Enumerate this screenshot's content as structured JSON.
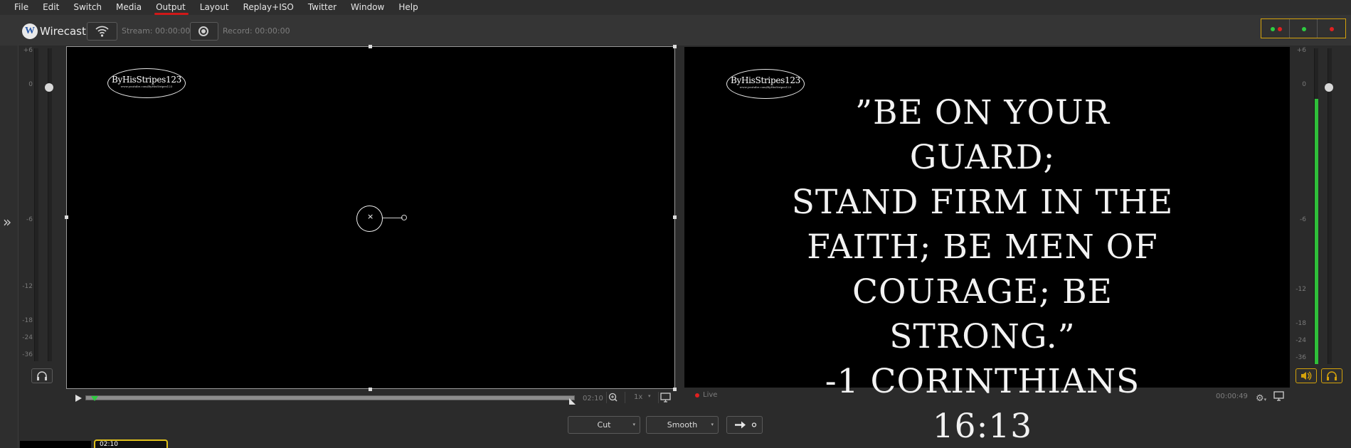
{
  "menu": [
    "File",
    "Edit",
    "Switch",
    "Media",
    "Output",
    "Layout",
    "Replay+ISO",
    "Twitter",
    "Window",
    "Help"
  ],
  "toolbar": {
    "app_name": "Wirecast",
    "stream_label": "Stream: 00:00:00",
    "record_label": "Record: 00:00:00",
    "status_colors": [
      "#2ecc40",
      "#e02020"
    ]
  },
  "meter_scale": [
    "+6",
    "0",
    "-6",
    "-12",
    "-18",
    "-24",
    "-36"
  ],
  "preview": {
    "watermark_title": "ByHisStripes123",
    "watermark_url": "www.youtube.com/ByHisStripes123",
    "duration": "02:10",
    "speed": "1x"
  },
  "live": {
    "watermark_title": "ByHisStripes123",
    "watermark_url": "www.youtube.com/ByHisStripes123",
    "verse_lines": [
      "”BE ON YOUR GUARD;",
      "STAND FIRM IN THE",
      "FAITH; BE MEN OF",
      "COURAGE; BE",
      "STRONG.”",
      "-1 CORINTHIANS 16:13"
    ],
    "live_label": "Live",
    "timecode": "00:00:49",
    "audio_level": 0.84
  },
  "transition": {
    "cut_label": "Cut",
    "smooth_label": "Smooth"
  },
  "shots": {
    "active_time": "02:10"
  }
}
